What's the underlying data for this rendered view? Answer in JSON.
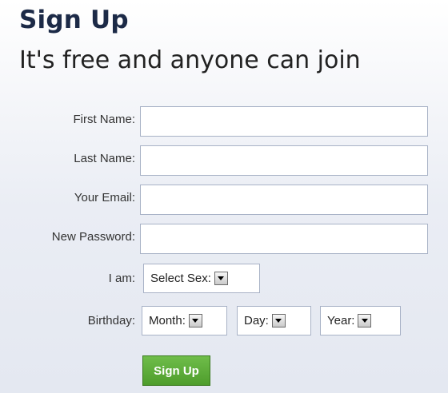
{
  "header": {
    "title": "Sign Up",
    "subtitle": "It's free and anyone can join"
  },
  "form": {
    "first_name": {
      "label": "First Name:",
      "value": "",
      "placeholder": ""
    },
    "last_name": {
      "label": "Last Name:",
      "value": "",
      "placeholder": ""
    },
    "email": {
      "label": "Your Email:",
      "value": "",
      "placeholder": ""
    },
    "password": {
      "label": "New Password:",
      "value": "",
      "placeholder": ""
    },
    "sex": {
      "label": "I am:",
      "selected": "Select Sex:"
    },
    "birthday": {
      "label": "Birthday:",
      "month": "Month:",
      "day": "Day:",
      "year": "Year:"
    },
    "submit_label": "Sign Up"
  },
  "icons": {
    "dropdown": "chevron-down-icon"
  },
  "colors": {
    "title": "#1c2a47",
    "button": "#5aa93a",
    "input_border": "#a8b2c6"
  }
}
